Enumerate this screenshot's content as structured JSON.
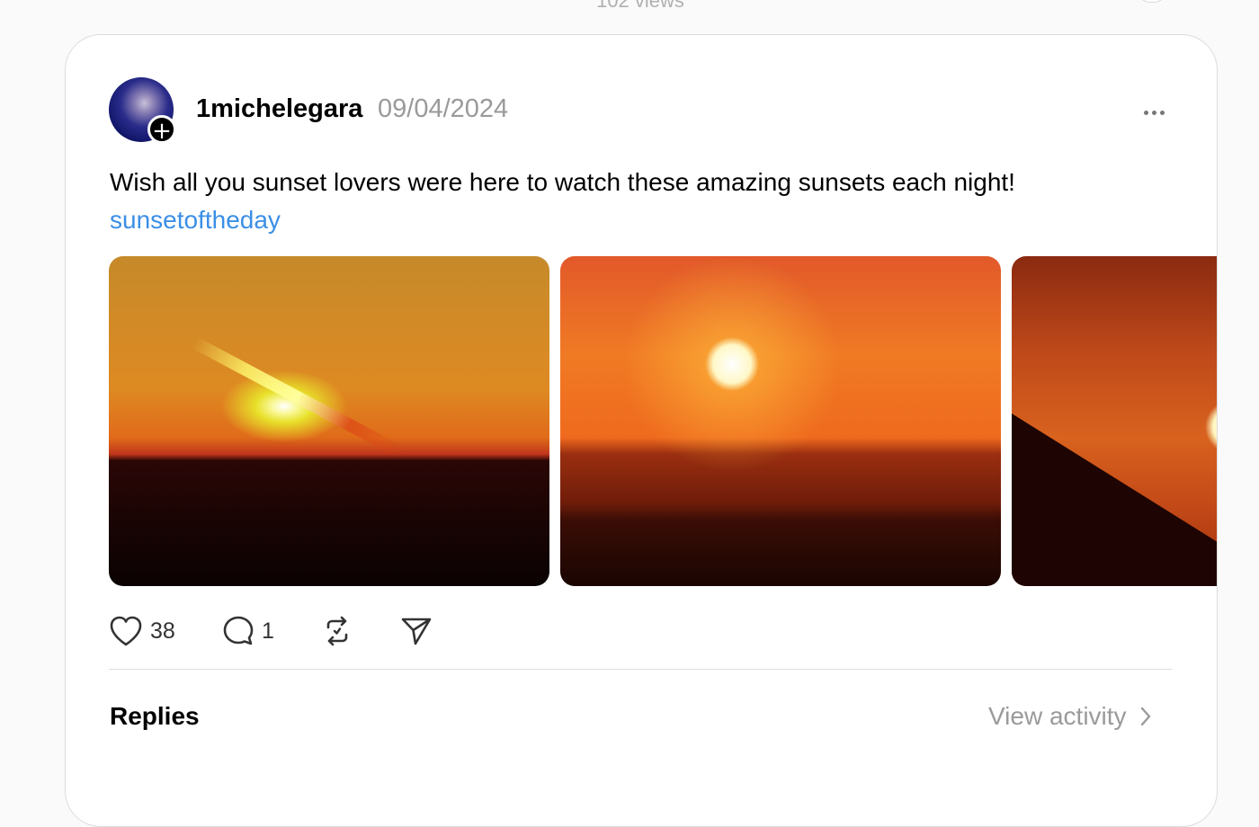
{
  "header": {
    "views_text": "102 views"
  },
  "post": {
    "username": "1michelegara",
    "date": "09/04/2024",
    "text": "Wish all you sunset lovers were here to watch these amazing sunsets each night!",
    "hashtag": "sunsetoftheday",
    "images": [
      "sunset-photo-1",
      "sunset-photo-2",
      "sunset-photo-3"
    ],
    "actions": {
      "likes": "38",
      "replies": "1",
      "repost_icon": "repost-icon",
      "share_icon": "share-icon"
    }
  },
  "footer": {
    "replies_label": "Replies",
    "view_activity_label": "View activity"
  },
  "colors": {
    "hashtag": "#3b8fe6",
    "muted": "#9a9a9a",
    "card_border": "#dcdcdc"
  }
}
